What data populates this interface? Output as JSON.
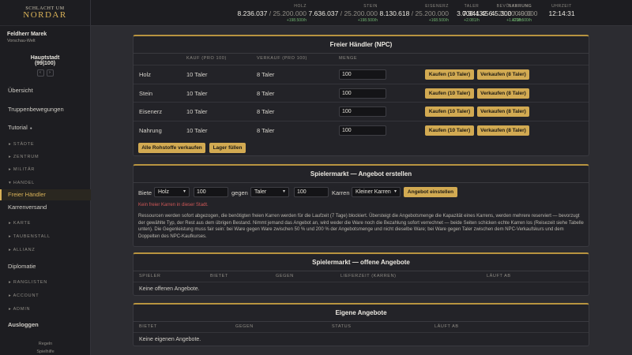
{
  "app": {
    "logo_line1": "SCHLACHT UM",
    "logo_line2": "NORDAR"
  },
  "user": {
    "name": "Feldherr Marek",
    "world": "Vorschau-Welt"
  },
  "city": {
    "name": "Hauptstadt",
    "coords": "(99|100)",
    "prev": "‹",
    "next": "›"
  },
  "nav": {
    "overview": "Übersicht",
    "troops": "Truppenbewegungen",
    "tutorial": "Tutorial",
    "tutorial_dot": "●",
    "staedte": "STÄDTE",
    "zentrum": "ZENTRUM",
    "militaer": "MILITÄR",
    "handel": "HANDEL",
    "freier_haendler": "Freier Händler",
    "karrenversand": "Karrenversand",
    "karte": "KARTE",
    "taubenstall": "TAUBENSTALL",
    "allianz": "ALLIANZ",
    "diplomatie": "Diplomatie",
    "ranglisten": "RANGLISTEN",
    "account": "ACCOUNT",
    "admin": "ADMIN",
    "logout": "Ausloggen",
    "arrow_closed": "▸",
    "arrow_open": "▾"
  },
  "footer": {
    "rules": "Regeln",
    "tips": "Spielhilfe"
  },
  "resources": [
    {
      "label": "HOLZ",
      "value": "8.236.037",
      "cap": "/ 25.200.000",
      "rate": "+198.500/h"
    },
    {
      "label": "STEIN",
      "value": "7.636.037",
      "cap": "/ 25.200.000",
      "rate": "+198.500/h"
    },
    {
      "label": "EISENERZ",
      "value": "8.130.618",
      "cap": "/ 25.200.000",
      "rate": "+168.500/h"
    },
    {
      "label": "NAHRUNG",
      "value": "7.941.456",
      "cap": "/ 25.200.000",
      "rate": "+218.500/h"
    },
    {
      "label": "TALER",
      "value": "3.000.432",
      "cap": "",
      "rate": "+2.081/h"
    },
    {
      "label": "BEVÖLKERUNG",
      "value": "45.300",
      "cap": "/ 49.000",
      "rate": "+1.870/h"
    },
    {
      "label": "UHRZEIT",
      "value": "12:14:31",
      "cap": "",
      "rate": ""
    }
  ],
  "npc": {
    "title": "Freier Händler (NPC)",
    "headers": {
      "buy": "KAUF (PRO 100)",
      "sell": "VERKAUF (PRO 100)",
      "qty": "MENGE"
    },
    "rows": [
      {
        "name": "Holz",
        "buy": "10 Taler",
        "sell": "8 Taler",
        "qty": "100",
        "buy_btn": "Kaufen (10 Taler)",
        "sell_btn": "Verkaufen (8 Taler)"
      },
      {
        "name": "Stein",
        "buy": "10 Taler",
        "sell": "8 Taler",
        "qty": "100",
        "buy_btn": "Kaufen (10 Taler)",
        "sell_btn": "Verkaufen (8 Taler)"
      },
      {
        "name": "Eisenerz",
        "buy": "10 Taler",
        "sell": "8 Taler",
        "qty": "100",
        "buy_btn": "Kaufen (10 Taler)",
        "sell_btn": "Verkaufen (8 Taler)"
      },
      {
        "name": "Nahrung",
        "buy": "10 Taler",
        "sell": "8 Taler",
        "qty": "100",
        "buy_btn": "Kaufen (10 Taler)",
        "sell_btn": "Verkaufen (8 Taler)"
      }
    ],
    "sell_all": "Alle Rohstoffe verkaufen",
    "fill": "Lager füllen"
  },
  "offer": {
    "title": "Spielermarkt — Angebot erstellen",
    "offer_label": "Biete",
    "offer_res": "Holz",
    "offer_qty": "100",
    "for_label": "gegen",
    "want_res": "Taler",
    "want_qty": "100",
    "carts_label": "Karren",
    "cart_type": "Kleiner Karren",
    "submit": "Angebot einstellen",
    "error": "Kein freier Karren in dieser Stadt.",
    "description": "Ressourcen werden sofort abgezogen, die benötigten freien Karren werden für die Laufzeit (7 Tage) blockiert. Übersteigt die Angebotsmenge die Kapazität eines Karrens, werden mehrere reserviert — bevorzugt der gewählte Typ, der Rest aus dem übrigen Bestand. Nimmt jemand das Angebot an, wird weder die Ware noch die Bezahlung sofort verrechnet — beide Seiten schicken echte Karren los (Reisezeit siehe Tabelle unten). Die Gegenleistung muss fair sein: bei Ware gegen Ware zwischen 50 % und 200 % der Angebotsmenge und nicht dieselbe Ware; bei Ware gegen Taler zwischen dem NPC-Verkaufskurs und dem Doppelten des NPC-Kaufkurses."
  },
  "open_offers": {
    "title": "Spielermarkt — offene Angebote",
    "headers": {
      "player": "SPIELER",
      "offers": "BIETET",
      "for": "GEGEN",
      "delivery": "LIEFERZEIT (KARREN)",
      "expires": "LÄUFT AB"
    },
    "empty": "Keine offenen Angebote."
  },
  "own_offers": {
    "title": "Eigene Angebote",
    "headers": {
      "offers": "BIETET",
      "for": "GEGEN",
      "status": "STATUS",
      "expires": "LÄUFT AB"
    },
    "empty": "Keine eigenen Angebote."
  },
  "colors": {
    "accent": "#d2aa52",
    "background": "#2c2c31",
    "sidebar": "#1d1d21",
    "error": "#d05858",
    "positive": "#6fb36f"
  }
}
